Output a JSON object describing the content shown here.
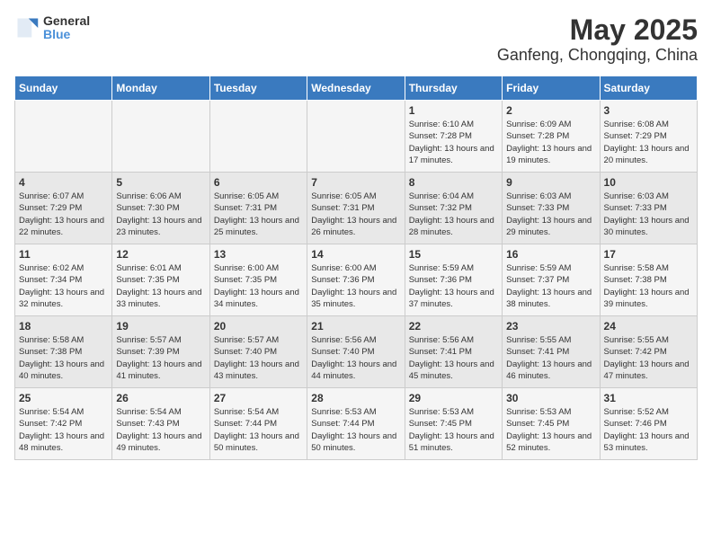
{
  "logo": {
    "line1": "General",
    "line2": "Blue"
  },
  "title": "May 2025",
  "subtitle": "Ganfeng, Chongqing, China",
  "days_of_week": [
    "Sunday",
    "Monday",
    "Tuesday",
    "Wednesday",
    "Thursday",
    "Friday",
    "Saturday"
  ],
  "weeks": [
    [
      {
        "day": "",
        "info": ""
      },
      {
        "day": "",
        "info": ""
      },
      {
        "day": "",
        "info": ""
      },
      {
        "day": "",
        "info": ""
      },
      {
        "day": "1",
        "info": "Sunrise: 6:10 AM\nSunset: 7:28 PM\nDaylight: 13 hours and 17 minutes."
      },
      {
        "day": "2",
        "info": "Sunrise: 6:09 AM\nSunset: 7:28 PM\nDaylight: 13 hours and 19 minutes."
      },
      {
        "day": "3",
        "info": "Sunrise: 6:08 AM\nSunset: 7:29 PM\nDaylight: 13 hours and 20 minutes."
      }
    ],
    [
      {
        "day": "4",
        "info": "Sunrise: 6:07 AM\nSunset: 7:29 PM\nDaylight: 13 hours and 22 minutes."
      },
      {
        "day": "5",
        "info": "Sunrise: 6:06 AM\nSunset: 7:30 PM\nDaylight: 13 hours and 23 minutes."
      },
      {
        "day": "6",
        "info": "Sunrise: 6:05 AM\nSunset: 7:31 PM\nDaylight: 13 hours and 25 minutes."
      },
      {
        "day": "7",
        "info": "Sunrise: 6:05 AM\nSunset: 7:31 PM\nDaylight: 13 hours and 26 minutes."
      },
      {
        "day": "8",
        "info": "Sunrise: 6:04 AM\nSunset: 7:32 PM\nDaylight: 13 hours and 28 minutes."
      },
      {
        "day": "9",
        "info": "Sunrise: 6:03 AM\nSunset: 7:33 PM\nDaylight: 13 hours and 29 minutes."
      },
      {
        "day": "10",
        "info": "Sunrise: 6:03 AM\nSunset: 7:33 PM\nDaylight: 13 hours and 30 minutes."
      }
    ],
    [
      {
        "day": "11",
        "info": "Sunrise: 6:02 AM\nSunset: 7:34 PM\nDaylight: 13 hours and 32 minutes."
      },
      {
        "day": "12",
        "info": "Sunrise: 6:01 AM\nSunset: 7:35 PM\nDaylight: 13 hours and 33 minutes."
      },
      {
        "day": "13",
        "info": "Sunrise: 6:00 AM\nSunset: 7:35 PM\nDaylight: 13 hours and 34 minutes."
      },
      {
        "day": "14",
        "info": "Sunrise: 6:00 AM\nSunset: 7:36 PM\nDaylight: 13 hours and 35 minutes."
      },
      {
        "day": "15",
        "info": "Sunrise: 5:59 AM\nSunset: 7:36 PM\nDaylight: 13 hours and 37 minutes."
      },
      {
        "day": "16",
        "info": "Sunrise: 5:59 AM\nSunset: 7:37 PM\nDaylight: 13 hours and 38 minutes."
      },
      {
        "day": "17",
        "info": "Sunrise: 5:58 AM\nSunset: 7:38 PM\nDaylight: 13 hours and 39 minutes."
      }
    ],
    [
      {
        "day": "18",
        "info": "Sunrise: 5:58 AM\nSunset: 7:38 PM\nDaylight: 13 hours and 40 minutes."
      },
      {
        "day": "19",
        "info": "Sunrise: 5:57 AM\nSunset: 7:39 PM\nDaylight: 13 hours and 41 minutes."
      },
      {
        "day": "20",
        "info": "Sunrise: 5:57 AM\nSunset: 7:40 PM\nDaylight: 13 hours and 43 minutes."
      },
      {
        "day": "21",
        "info": "Sunrise: 5:56 AM\nSunset: 7:40 PM\nDaylight: 13 hours and 44 minutes."
      },
      {
        "day": "22",
        "info": "Sunrise: 5:56 AM\nSunset: 7:41 PM\nDaylight: 13 hours and 45 minutes."
      },
      {
        "day": "23",
        "info": "Sunrise: 5:55 AM\nSunset: 7:41 PM\nDaylight: 13 hours and 46 minutes."
      },
      {
        "day": "24",
        "info": "Sunrise: 5:55 AM\nSunset: 7:42 PM\nDaylight: 13 hours and 47 minutes."
      }
    ],
    [
      {
        "day": "25",
        "info": "Sunrise: 5:54 AM\nSunset: 7:42 PM\nDaylight: 13 hours and 48 minutes."
      },
      {
        "day": "26",
        "info": "Sunrise: 5:54 AM\nSunset: 7:43 PM\nDaylight: 13 hours and 49 minutes."
      },
      {
        "day": "27",
        "info": "Sunrise: 5:54 AM\nSunset: 7:44 PM\nDaylight: 13 hours and 50 minutes."
      },
      {
        "day": "28",
        "info": "Sunrise: 5:53 AM\nSunset: 7:44 PM\nDaylight: 13 hours and 50 minutes."
      },
      {
        "day": "29",
        "info": "Sunrise: 5:53 AM\nSunset: 7:45 PM\nDaylight: 13 hours and 51 minutes."
      },
      {
        "day": "30",
        "info": "Sunrise: 5:53 AM\nSunset: 7:45 PM\nDaylight: 13 hours and 52 minutes."
      },
      {
        "day": "31",
        "info": "Sunrise: 5:52 AM\nSunset: 7:46 PM\nDaylight: 13 hours and 53 minutes."
      }
    ]
  ]
}
